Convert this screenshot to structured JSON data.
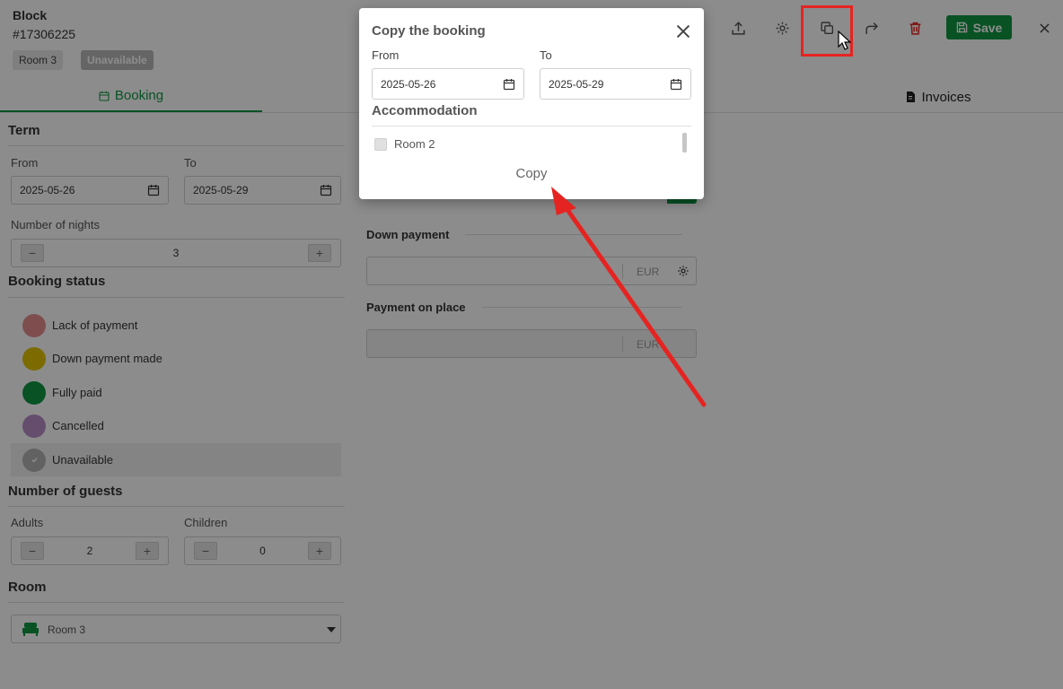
{
  "header": {
    "title": "Block",
    "booking_id": "#17306225",
    "room_badge": "Room 3",
    "status_badge": "Unavailable",
    "save_label": "Save",
    "toolbar_icons": [
      "upload-icon",
      "gear-icon",
      "copy-icon",
      "forward-icon",
      "trash-icon"
    ]
  },
  "tabs": {
    "booking": "Booking",
    "invoices": "Invoices"
  },
  "term": {
    "title": "Term",
    "from_label": "From",
    "from_value": "2025-05-26",
    "to_label": "To",
    "to_value": "2025-05-29",
    "nights_label": "Number of nights",
    "nights_value": "3"
  },
  "booking_status": {
    "title": "Booking status",
    "options": [
      {
        "label": "Lack of payment",
        "color": "#e58e8e"
      },
      {
        "label": "Down payment made",
        "color": "#e0c300"
      },
      {
        "label": "Fully paid",
        "color": "#0f9642"
      },
      {
        "label": "Cancelled",
        "color": "#b98cc9"
      },
      {
        "label": "Unavailable",
        "color": "#b3b3b3"
      }
    ],
    "selected": "Unavailable"
  },
  "guests": {
    "title": "Number of guests",
    "adults_label": "Adults",
    "adults_value": "2",
    "children_label": "Children",
    "children_value": "0"
  },
  "room": {
    "title": "Room",
    "selected": "Room 3"
  },
  "payments": {
    "down_payment_label": "Down payment",
    "down_payment_currency": "EUR",
    "on_place_label": "Payment on place",
    "on_place_currency": "EUR"
  },
  "modal": {
    "title": "Copy the booking",
    "from_label": "From",
    "from_value": "2025-05-26",
    "to_label": "To",
    "to_value": "2025-05-29",
    "accommodation_label": "Accommodation",
    "rooms": [
      "Room 2"
    ],
    "copy_label": "Copy"
  },
  "colors": {
    "accent": "#0f9642",
    "delete": "#e52421",
    "highlight": "#e52421"
  }
}
